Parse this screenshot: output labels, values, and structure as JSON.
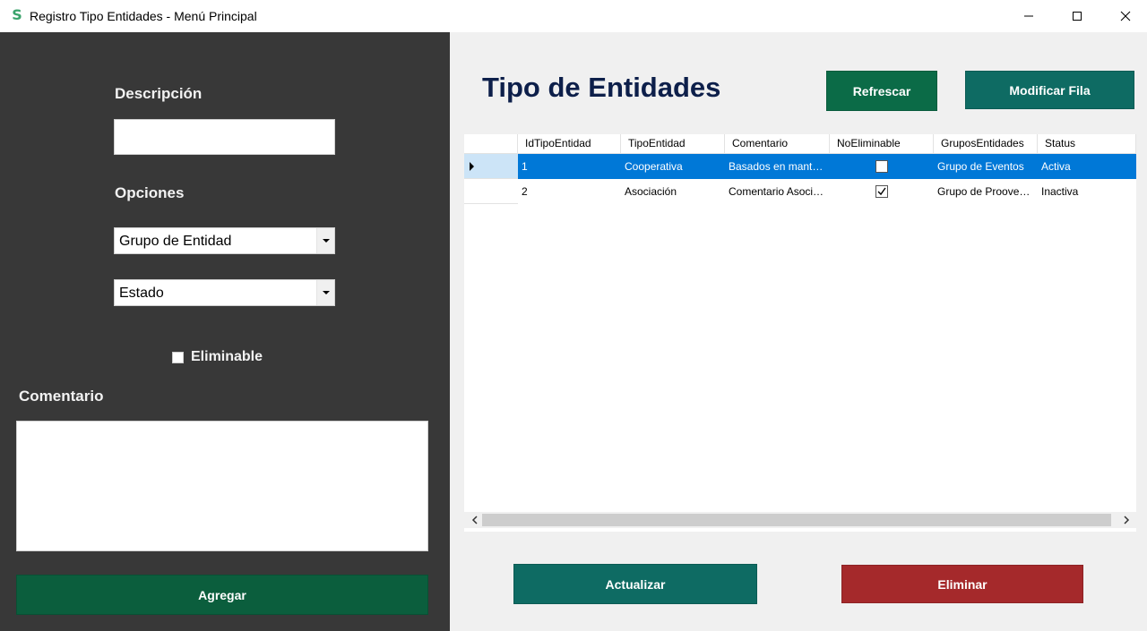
{
  "window": {
    "title": "Registro Tipo Entidades - Menú Principal",
    "app_icon": "S"
  },
  "form": {
    "descripcion_label": "Descripción",
    "descripcion_value": "",
    "opciones_label": "Opciones",
    "grupo_select": "Grupo de Entidad",
    "estado_select": "Estado",
    "eliminable_label": "Eliminable",
    "eliminable_checked": false,
    "comentario_label": "Comentario",
    "comentario_value": "",
    "agregar_label": "Agregar"
  },
  "main": {
    "title": "Tipo de Entidades",
    "refrescar_label": "Refrescar",
    "modificar_label": "Modificar Fila",
    "actualizar_label": "Actualizar",
    "eliminar_label": "Eliminar"
  },
  "grid": {
    "columns": [
      "IdTipoEntidad",
      "TipoEntidad",
      "Comentario",
      "NoEliminable",
      "GruposEntidades",
      "Status"
    ],
    "rows": [
      {
        "id": "1",
        "tipo": "Cooperativa",
        "comentario": "Basados en mant…",
        "no_eliminable": false,
        "grupo": "Grupo de Eventos",
        "status": "Activa",
        "selected": true
      },
      {
        "id": "2",
        "tipo": "Asociación",
        "comentario": "Comentario Asoci…",
        "no_eliminable": true,
        "grupo": "Grupo de Proove…",
        "status": "Inactiva",
        "selected": false
      }
    ]
  },
  "colors": {
    "left_panel": "#383838",
    "right_panel": "#f0f0f0",
    "agregar": "#0b5e3d",
    "refrescar": "#0b6b47",
    "modificar": "#0e6b63",
    "actualizar": "#0e6b63",
    "eliminar": "#a5292b",
    "selection": "#0078d7",
    "title": "#0d1f4a"
  }
}
